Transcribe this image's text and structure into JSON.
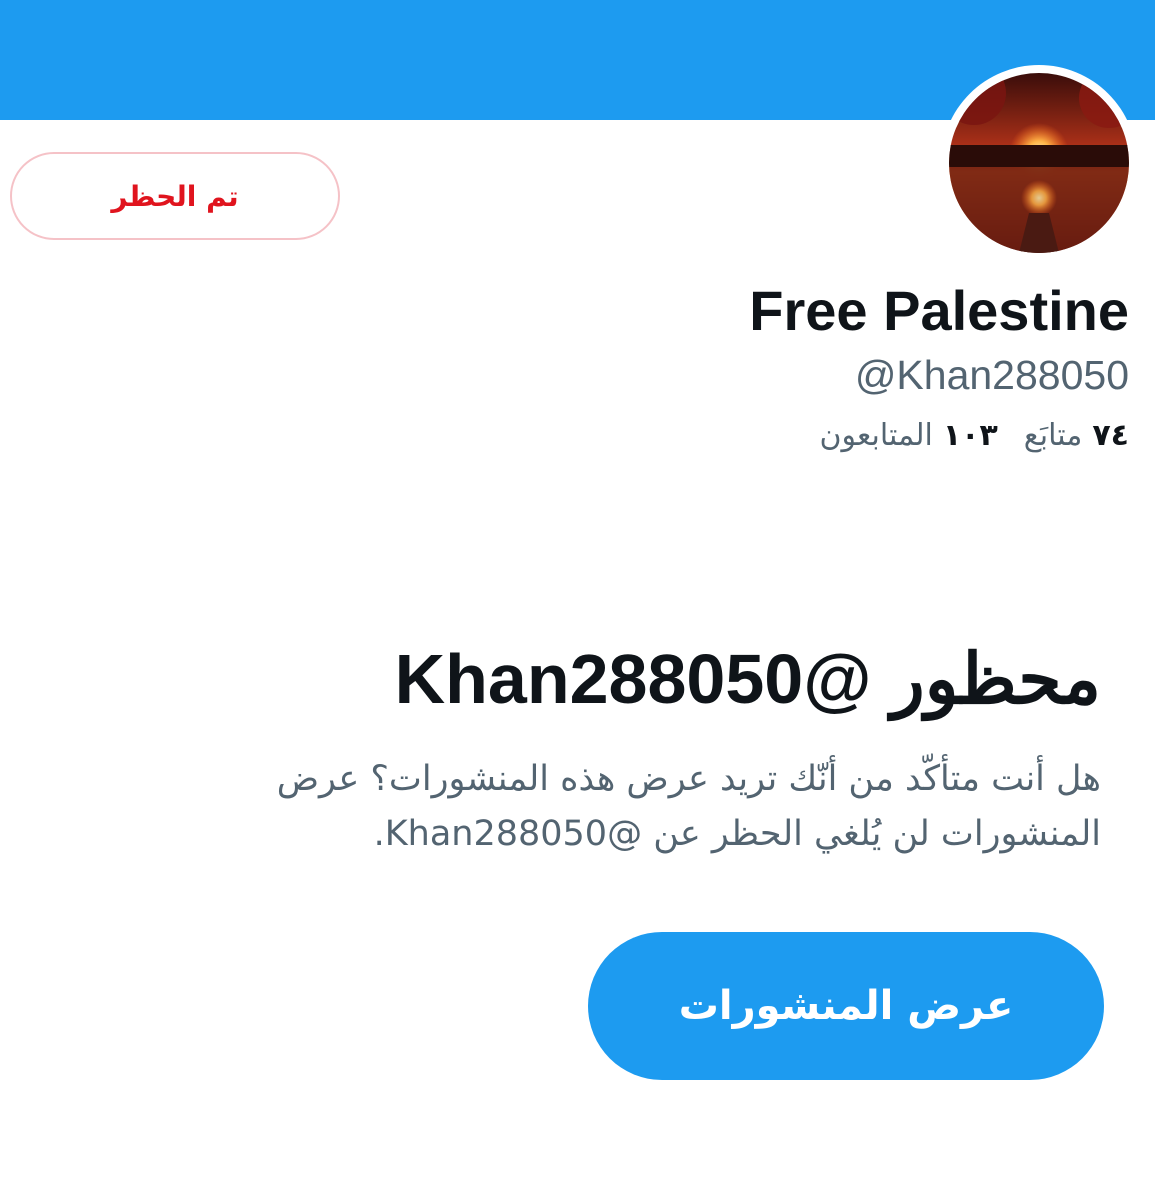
{
  "profile": {
    "display_name": "Free Palestine",
    "handle": "@Khan288050",
    "following_count": "٧٤",
    "following_label": "متابَع",
    "followers_count": "١٠٣",
    "followers_label": "المتابعون"
  },
  "actions": {
    "blocked_label": "تم الحظر",
    "view_posts_label": "عرض المنشورات"
  },
  "blocked_notice": {
    "title": "محظور @Khan288050",
    "description": "هل أنت متأكّد من أنّك تريد عرض هذه المنشورات؟ عرض المنشورات لن يُلغي الحظر عن @Khan288050."
  },
  "colors": {
    "accent": "#1d9bf0",
    "blocked_red": "#e0141e",
    "text_primary": "#0f1419",
    "text_secondary": "#536471"
  },
  "icons": {
    "avatar_image": "sunset-lake-avatar"
  }
}
